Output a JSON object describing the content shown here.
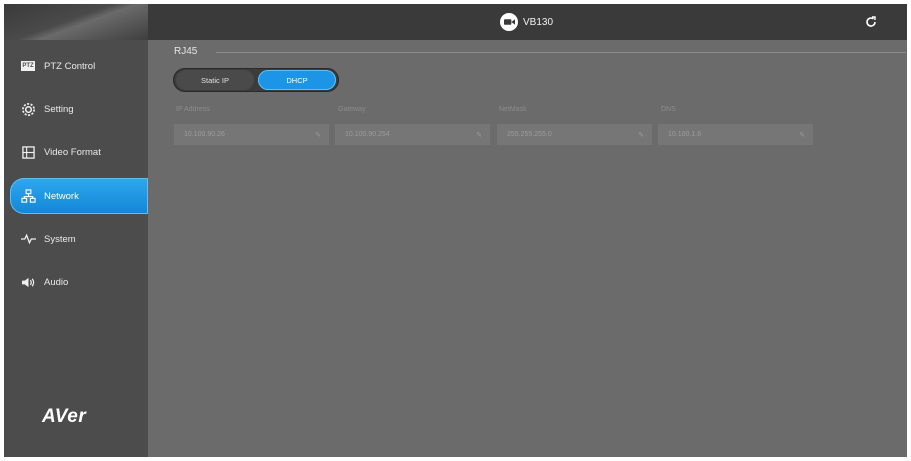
{
  "header": {
    "device_name": "VB130"
  },
  "sidebar": {
    "items": [
      {
        "label": "PTZ Control",
        "icon": "ptz-icon",
        "active": false
      },
      {
        "label": "Setting",
        "icon": "gear-icon",
        "active": false
      },
      {
        "label": "Video Format",
        "icon": "film-icon",
        "active": false
      },
      {
        "label": "Network",
        "icon": "network-icon",
        "active": true
      },
      {
        "label": "System",
        "icon": "pulse-icon",
        "active": false
      },
      {
        "label": "Audio",
        "icon": "speaker-icon",
        "active": false
      }
    ],
    "logo": "AVer",
    "ptz_badge": "PTZ"
  },
  "main": {
    "section_title": "RJ45",
    "mode_toggle": {
      "options": [
        "Static IP",
        "DHCP"
      ],
      "selected": "DHCP"
    },
    "fields": [
      {
        "label": "IP Address",
        "value": "10.100.90.26"
      },
      {
        "label": "Gateway",
        "value": "10.100.90.254"
      },
      {
        "label": "NetMask",
        "value": "255.255.255.0"
      },
      {
        "label": "DNS",
        "value": "10.100.1.6"
      }
    ]
  },
  "colors": {
    "accent": "#1d95e6",
    "sidebar": "#4c4c4c",
    "header": "#3a3a3a",
    "content": "#6b6b6b"
  }
}
